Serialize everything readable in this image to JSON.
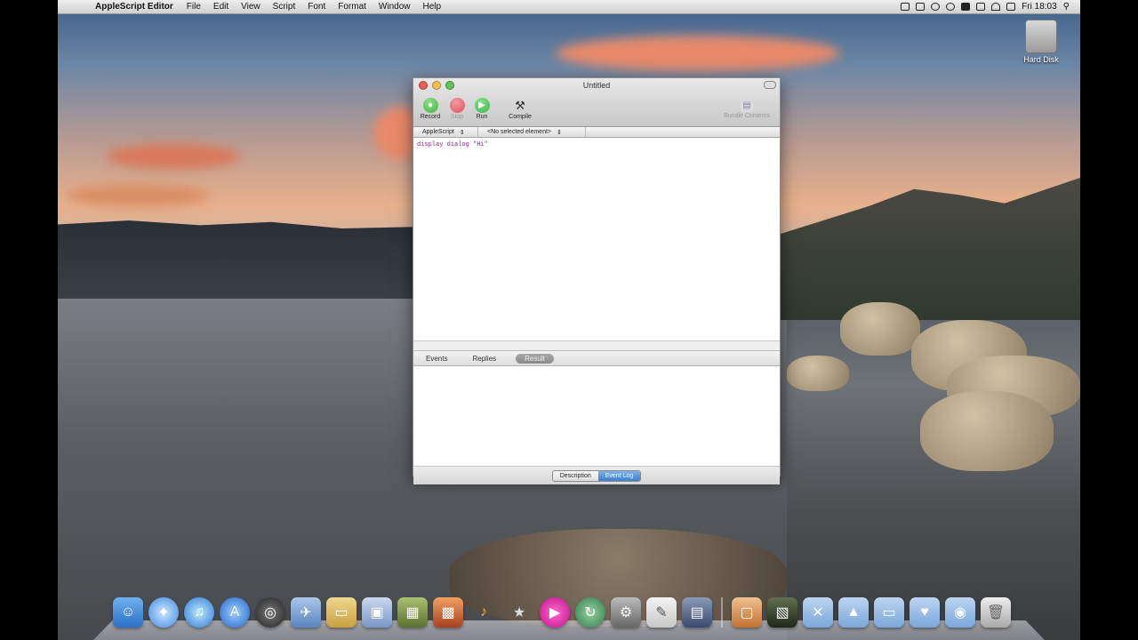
{
  "menubar": {
    "apple": "",
    "app_name": "AppleScript Editor",
    "items": [
      "File",
      "Edit",
      "View",
      "Script",
      "Font",
      "Format",
      "Window",
      "Help"
    ],
    "clock": "Fri 18:03"
  },
  "desktop": {
    "hd_label": "Hard Disk"
  },
  "window": {
    "title": "Untitled",
    "toolbar": {
      "record": "Record",
      "stop": "Stop",
      "run": "Run",
      "compile": "Compile",
      "bundle": "Bundle Contents"
    },
    "navbar": {
      "language": "AppleScript",
      "element": "<No selected element>"
    },
    "code": "display dialog \"Hi\"",
    "tabs": [
      "Events",
      "Replies",
      "Result"
    ],
    "bottom": {
      "description": "Description",
      "event_log": "Event Log"
    }
  },
  "colors": {
    "record": "#3cb43c",
    "stop": "#e0505a",
    "run": "#34b84a",
    "selection": "#3b7fd0"
  }
}
